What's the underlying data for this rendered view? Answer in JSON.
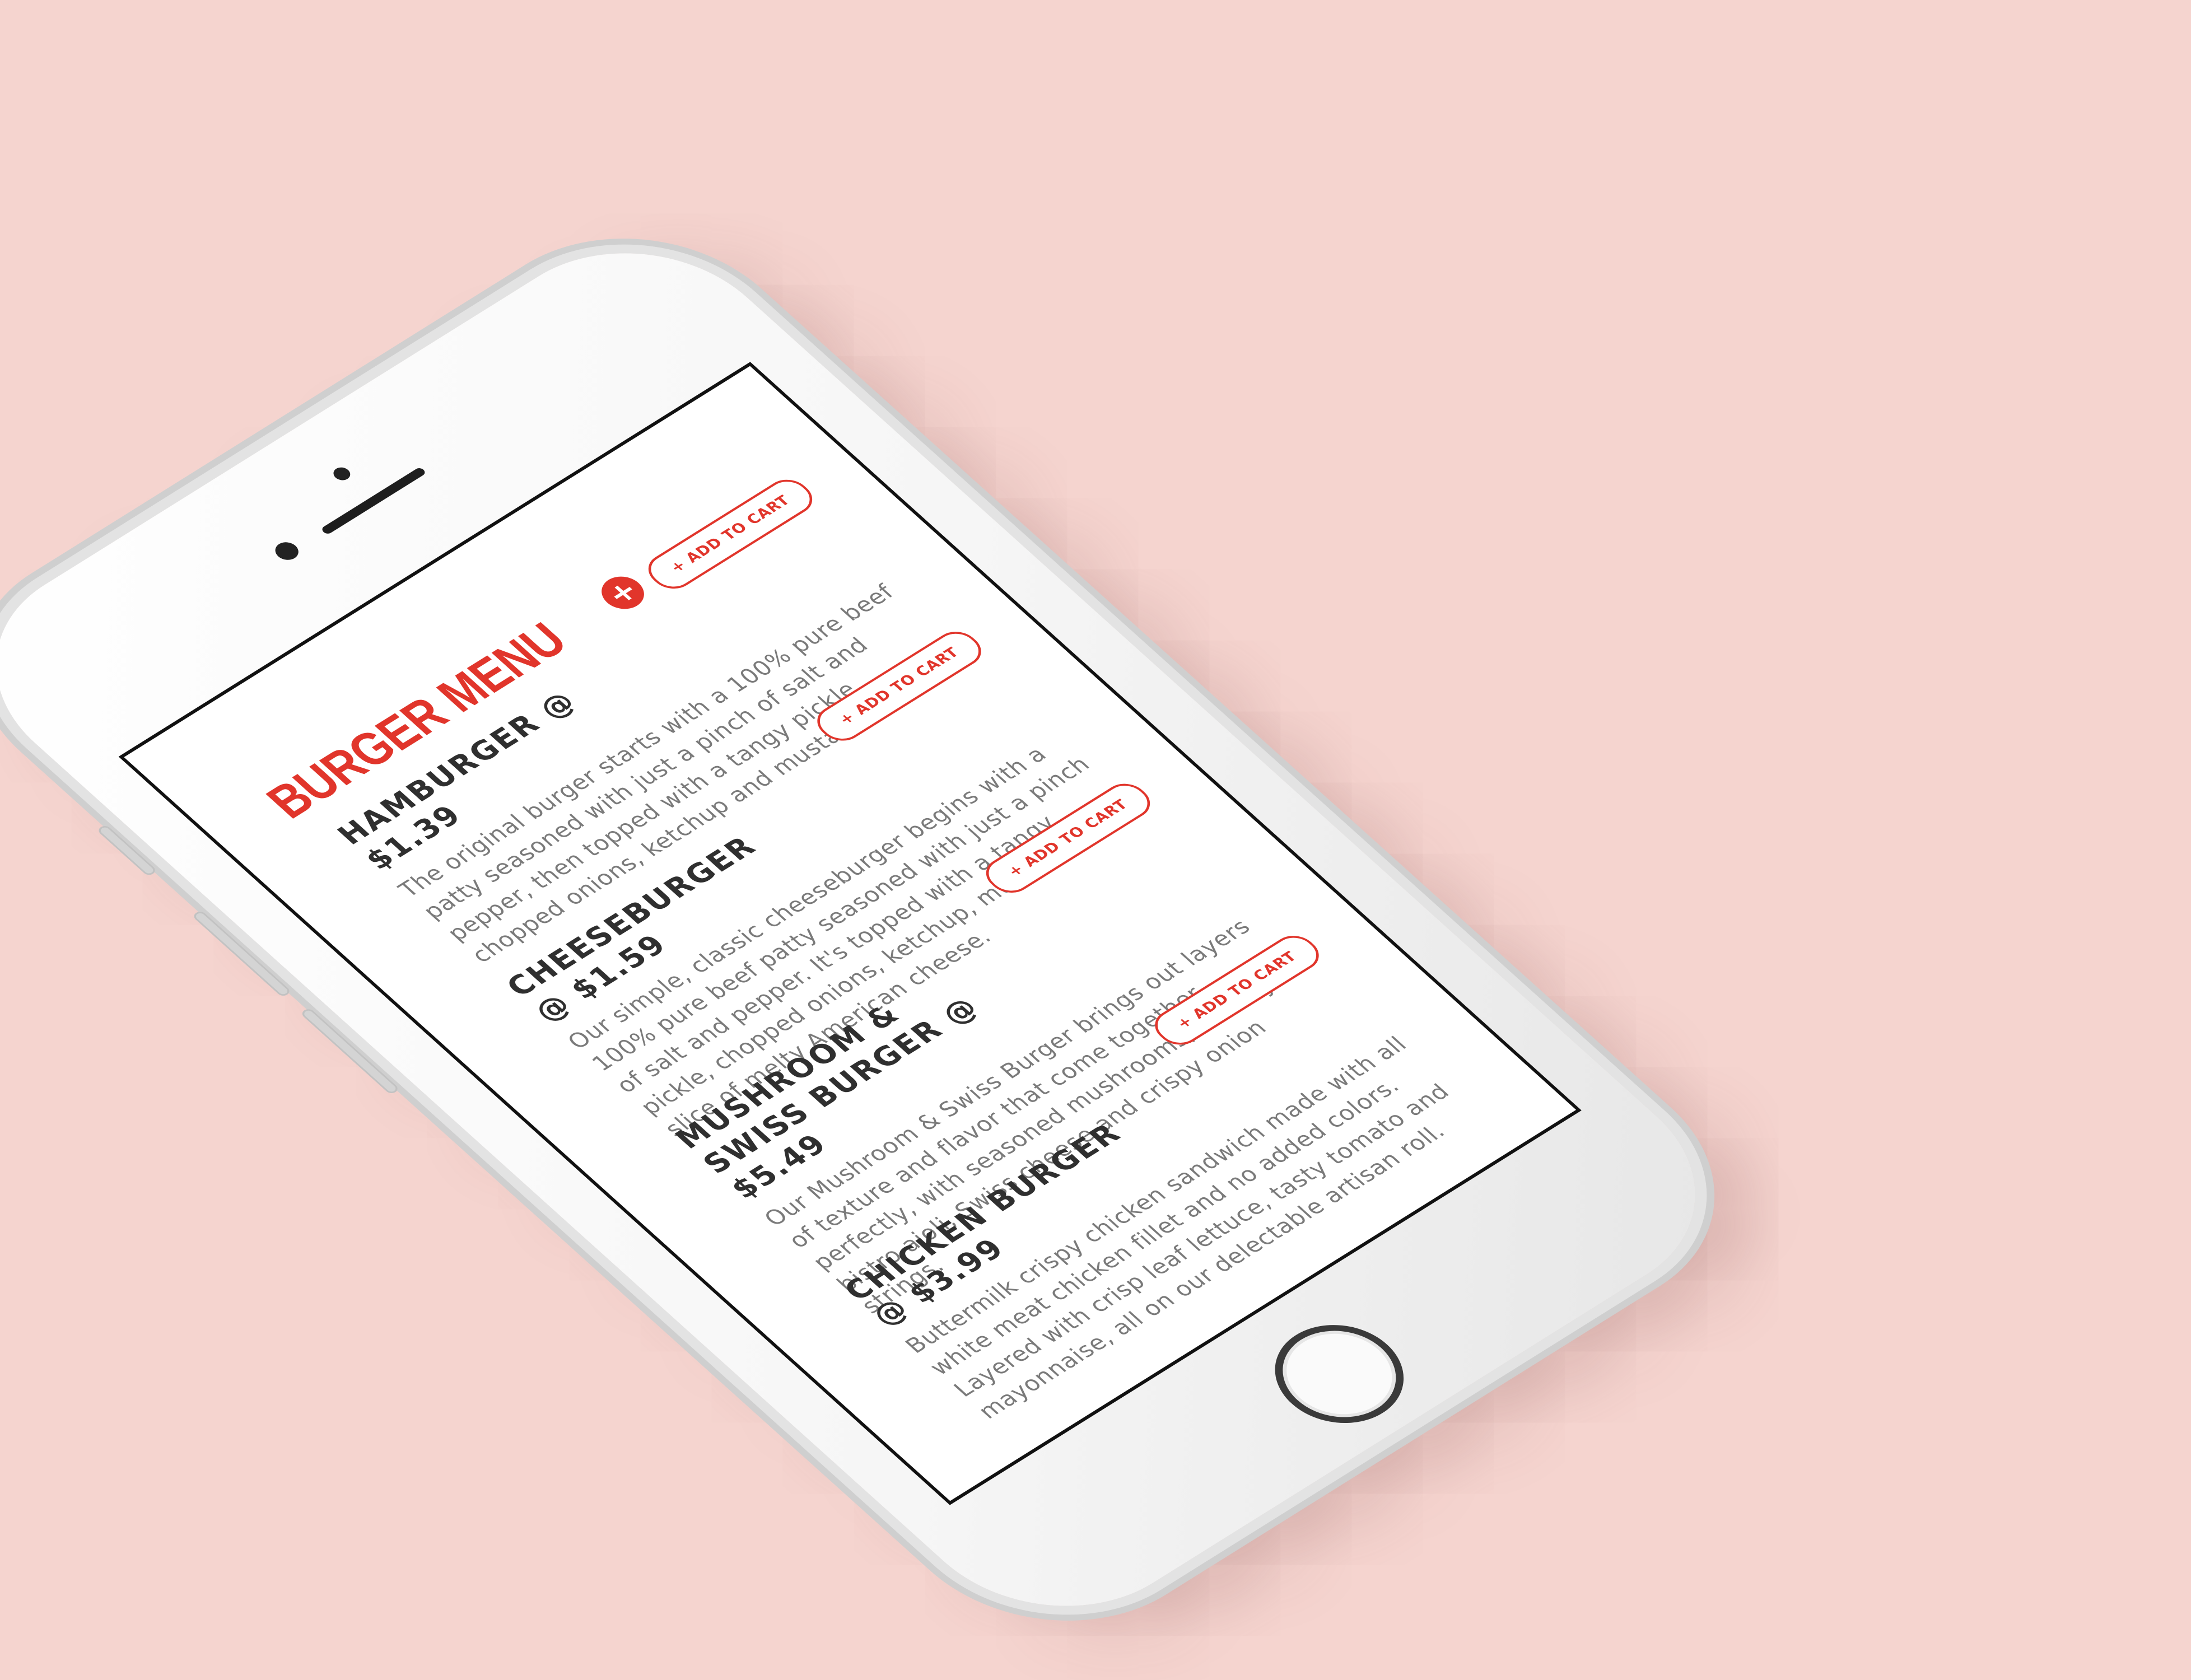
{
  "menu": {
    "title": "BURGER MENU",
    "add_icon": "+",
    "accent_color": "#e1352b"
  },
  "items": [
    {
      "name": "HAMBURGER @ $1.39",
      "description": "The original burger starts with a 100% pure beef patty seasoned with just a pinch of salt and pepper, then topped with a tangy pickle, chopped onions, ketchup and mustard.",
      "button": "+ ADD TO CART"
    },
    {
      "name": "CHEESEBURGER @ $1.59",
      "description": "Our simple, classic cheeseburger begins with a 100% pure beef patty seasoned with just a pinch of salt and pepper. It's topped with a tangy pickle, chopped onions, ketchup, mustard, and a slice of melty American cheese.",
      "button": "+ ADD TO CART"
    },
    {
      "name": "MUSHROOM & SWISS BURGER @ $5.49",
      "description": "Our Mushroom & Swiss Burger brings out layers of texture and flavor that come together perfectly, with seasoned mushrooms, creamy bistro aioli, Swiss cheese and crispy onion strings.",
      "button": "+ ADD TO CART"
    },
    {
      "name": "CHICKEN BURGER @ $3.99",
      "description": "Buttermilk crispy chicken sandwich made with all white meat chicken fillet and no added colors. Layered with crisp leaf lettuce, tasty tomato and mayonnaise, all on our delectable artisan roll.",
      "button": "+ ADD TO CART"
    }
  ]
}
